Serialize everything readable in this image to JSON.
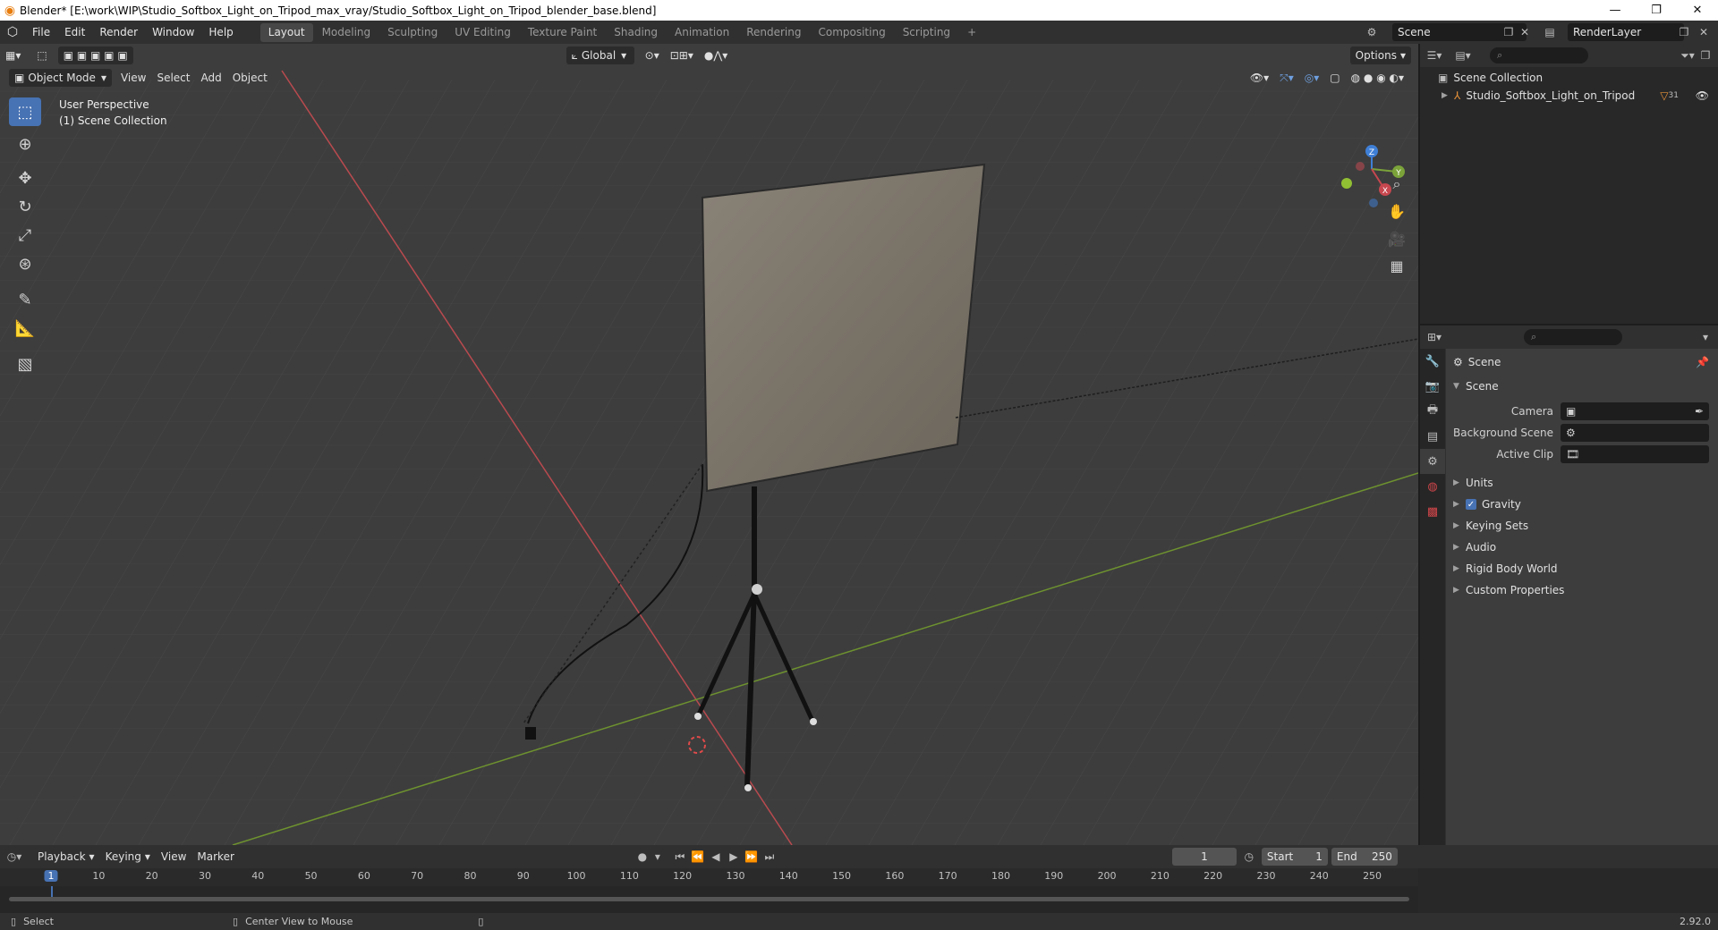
{
  "window": {
    "title": "Blender* [E:\\work\\WIP\\Studio_Softbox_Light_on_Tripod_max_vray/Studio_Softbox_Light_on_Tripod_blender_base.blend]",
    "minimize": "—",
    "maximize": "❐",
    "close": "✕"
  },
  "menu": [
    "File",
    "Edit",
    "Render",
    "Window",
    "Help"
  ],
  "workspaces": [
    "Layout",
    "Modeling",
    "Sculpting",
    "UV Editing",
    "Texture Paint",
    "Shading",
    "Animation",
    "Rendering",
    "Compositing",
    "Scripting"
  ],
  "workspace_add": "+",
  "scene_name": "Scene",
  "render_layer": "RenderLayer",
  "viewport": {
    "orientation": "Global",
    "options": "Options",
    "mode": "Object Mode",
    "header_menus": [
      "View",
      "Select",
      "Add",
      "Object"
    ],
    "info_line1": "User Perspective",
    "info_line2": "(1) Scene Collection",
    "gizmo_axes": {
      "x": "X",
      "y": "Y",
      "z": "Z"
    }
  },
  "outliner": {
    "collection": "Scene Collection",
    "object": "Studio_Softbox_Light_on_Tripod",
    "object_badge": "31"
  },
  "properties": {
    "context": "Scene",
    "panel": "Scene",
    "fields": [
      {
        "label": "Camera",
        "value": ""
      },
      {
        "label": "Background Scene",
        "value": ""
      },
      {
        "label": "Active Clip",
        "value": ""
      }
    ],
    "subpanels": [
      "Units",
      "Gravity",
      "Keying Sets",
      "Audio",
      "Rigid Body World",
      "Custom Properties"
    ]
  },
  "timeline": {
    "menus": [
      "Playback",
      "Keying",
      "View",
      "Marker"
    ],
    "current_frame": "1",
    "start_label": "Start",
    "start": "1",
    "end_label": "End",
    "end": "250",
    "ticks": [
      "1",
      "10",
      "20",
      "30",
      "40",
      "50",
      "60",
      "70",
      "80",
      "90",
      "100",
      "110",
      "120",
      "130",
      "140",
      "150",
      "160",
      "170",
      "180",
      "190",
      "200",
      "210",
      "220",
      "230",
      "240",
      "250"
    ]
  },
  "statusbar": {
    "left": "Select",
    "middle": "Center View to Mouse",
    "version": "2.92.0"
  },
  "colors": {
    "accent": "#4772b3",
    "x_axis": "#c7474f",
    "y_axis": "#7ba33a",
    "z_axis": "#3f7fd6"
  }
}
